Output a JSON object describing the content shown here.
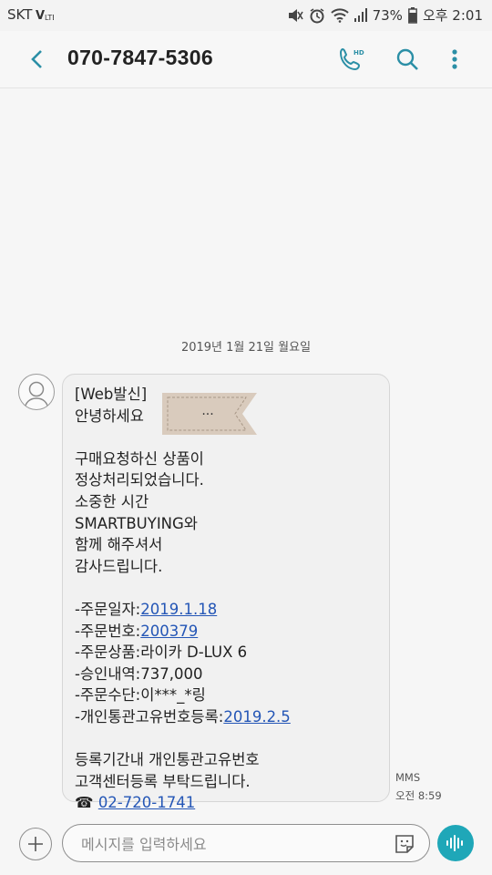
{
  "status_bar": {
    "carrier": "SKT",
    "battery": "73%",
    "time": "오후 2:01"
  },
  "header": {
    "contact": "070-7847-5306",
    "icons": [
      "back-arrow-icon",
      "hd-call-icon",
      "search-icon",
      "more-vert-icon"
    ]
  },
  "conversation": {
    "date": "2019년 1월 21일 월요일",
    "message": {
      "greeting_1": "[Web발신]",
      "greeting_2": "안녕하세요",
      "sticker_text": "...",
      "body": [
        "구매요청하신 상품이",
        "정상처리되었습니다.",
        "소중한 시간",
        "SMARTBUYING와",
        "함께 해주셔서",
        "감사드립니다."
      ],
      "order_date_label": "-주문일자:",
      "order_date": "2019.1.18",
      "order_no_label": "-주문번호:",
      "order_no": "200379",
      "product": "-주문상품:라이카 D-LUX 6",
      "approval": "-승인내역:737,000",
      "payment": "-주문수단:이***_*링",
      "customs_label": "-개인통관고유번호등록:",
      "customs_date": "2019.2.5",
      "closing_1": "등록기간내 개인통관고유번호",
      "closing_2": "고객센터등록 부탁드립니다.",
      "phone_icon": "☎",
      "phone": "02-720-1741",
      "type": "MMS",
      "time": "오전 8:59"
    }
  },
  "composer": {
    "placeholder": "메시지를 입력하세요",
    "accent": "#1fa7b8"
  }
}
